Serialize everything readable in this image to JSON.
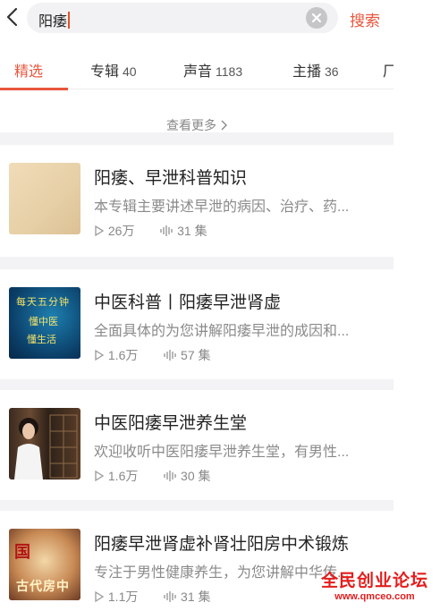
{
  "search": {
    "query": "阳痿",
    "button_label": "搜索"
  },
  "tabs": [
    {
      "label": "精选",
      "count": "",
      "active": true
    },
    {
      "label": "专辑",
      "count": "40"
    },
    {
      "label": "声音",
      "count": "1183"
    },
    {
      "label": "主播",
      "count": "36"
    },
    {
      "label": "厂",
      "count": ""
    }
  ],
  "see_more": "查看更多",
  "albums": [
    {
      "title": "阳痿、早泄科普知识",
      "desc": "本专辑主要讲述早泄的病因、治疗、药...",
      "plays": "26万",
      "episodes": "31 集"
    },
    {
      "title": "中医科普丨阳痿早泄肾虚",
      "desc": "全面具体的为您讲解阳痿早泄的成因和...",
      "plays": "1.6万",
      "episodes": "57 集",
      "cover_lines": [
        "每天五分钟",
        "懂中医",
        "懂生活"
      ]
    },
    {
      "title": "中医阳痿早泄养生堂",
      "desc": "欢迎收听中医阳痿早泄养生堂，有男性...",
      "plays": "1.6万",
      "episodes": "30 集"
    },
    {
      "title": "阳痿早泄肾虚补肾壮阳房中术锻炼",
      "desc": "专注于男性健康养生，为您讲解中华传...",
      "plays": "1.1万",
      "episodes": "31 集",
      "cover_lines": [
        "国",
        "古代房中"
      ]
    }
  ],
  "watermark": {
    "name": "全民创业论坛",
    "url": "www.qmceo.com"
  },
  "colors": {
    "accent": "#e8553c",
    "watermark": "#e41d1d"
  }
}
